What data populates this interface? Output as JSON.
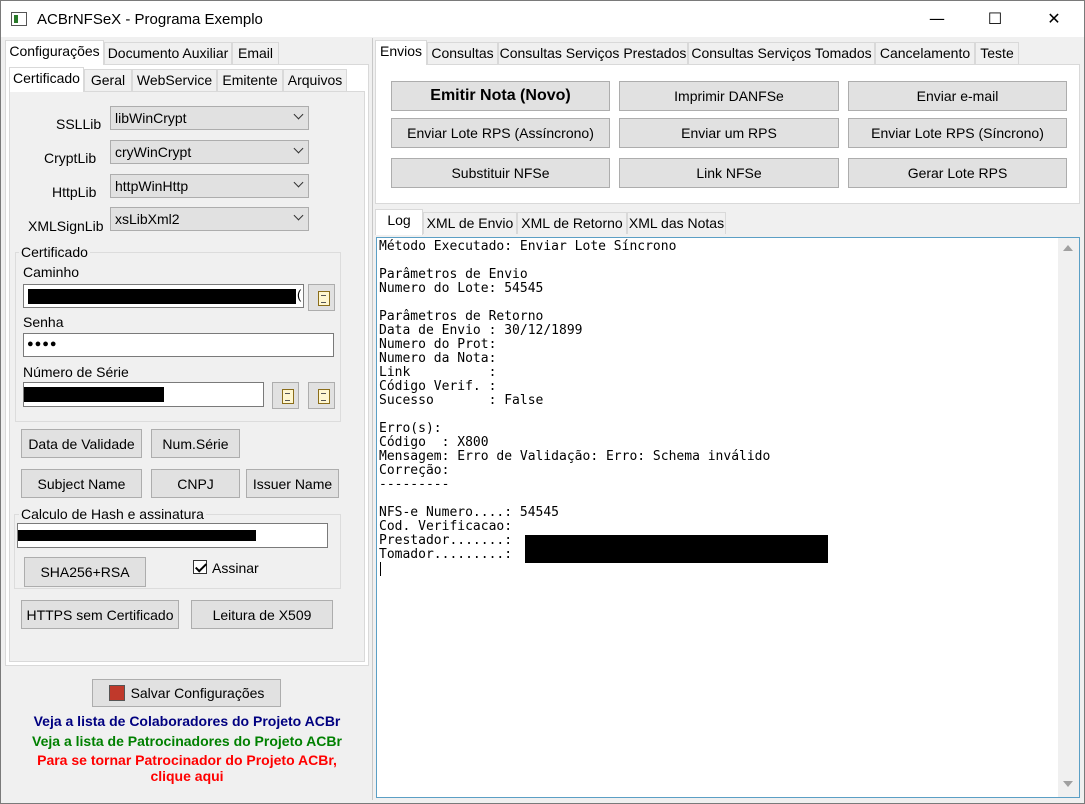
{
  "window": {
    "title": "ACBrNFSeX - Programa Exemplo",
    "minimize": "—",
    "maximize": "☐",
    "close": "✕"
  },
  "left_tabs": [
    "Configurações",
    "Documento Auxiliar",
    "Email"
  ],
  "config_tabs": [
    "Certificado",
    "Geral",
    "WebService",
    "Emitente",
    "Arquivos"
  ],
  "libs": [
    {
      "label": "SSLLib",
      "value": "libWinCrypt"
    },
    {
      "label": "CryptLib",
      "value": "cryWinCrypt"
    },
    {
      "label": "HttpLib",
      "value": "httpWinHttp"
    },
    {
      "label": "XMLSignLib",
      "value": "xsLibXml2"
    }
  ],
  "certificado": {
    "legend": "Certificado",
    "caminho_label": "Caminho",
    "caminho_tail": "(",
    "senha_label": "Senha",
    "senha_value": "●●●●",
    "serie_label": "Número de Série"
  },
  "cert_buttons": {
    "data_validade": "Data de Validade",
    "num_serie": "Num.Série",
    "subject_name": "Subject Name",
    "cnpj": "CNPJ",
    "issuer_name": "Issuer Name"
  },
  "hash": {
    "legend": "Calculo de Hash e assinatura",
    "sha_button": "SHA256+RSA",
    "assinar_label": "Assinar",
    "assinar_checked": true
  },
  "bottom_buttons": {
    "https": "HTTPS sem Certificado",
    "x509": "Leitura de X509"
  },
  "save_button": "Salvar Configurações",
  "links": {
    "colaboradores": "Veja a lista de Colaboradores do Projeto ACBr",
    "patrocinadores": "Veja a lista de Patrocinadores do Projeto ACBr",
    "tornar_line1": "Para se tornar Patrocinador do Projeto ACBr,",
    "tornar_line2": "clique aqui",
    "colors": {
      "colaboradores": "#000080",
      "patrocinadores": "#008000",
      "tornar": "#ff0000"
    }
  },
  "right_tabs": [
    "Envios",
    "Consultas",
    "Consultas Serviços Prestados",
    "Consultas Serviços Tomados",
    "Cancelamento",
    "Teste"
  ],
  "envios_buttons": [
    "Emitir Nota (Novo)",
    "Imprimir DANFSe",
    "Enviar e-mail",
    "Enviar Lote RPS (Assíncrono)",
    "Enviar um RPS",
    "Enviar Lote RPS (Síncrono)",
    "Substituir NFSe",
    "Link NFSe",
    "Gerar Lote RPS"
  ],
  "log_tabs": [
    "Log",
    "XML de Envio",
    "XML de Retorno",
    "XML das Notas"
  ],
  "log_lines": [
    "Método Executado: Enviar Lote Síncrono",
    "",
    "Parâmetros de Envio",
    "Numero do Lote: 54545",
    "",
    "Parâmetros de Retorno",
    "Data de Envio : 30/12/1899",
    "Numero do Prot:",
    "Numero da Nota:",
    "Link          :",
    "Código Verif. :",
    "Sucesso       : False",
    "",
    "Erro(s):",
    "Código  : X800",
    "Mensagem: Erro de Validação: Erro: Schema inválido",
    "Correção:",
    "---------",
    "",
    "NFS-e Numero....: 54545",
    "Cod. Verificacao:",
    "Prestador.......:",
    "Tomador.........:"
  ]
}
